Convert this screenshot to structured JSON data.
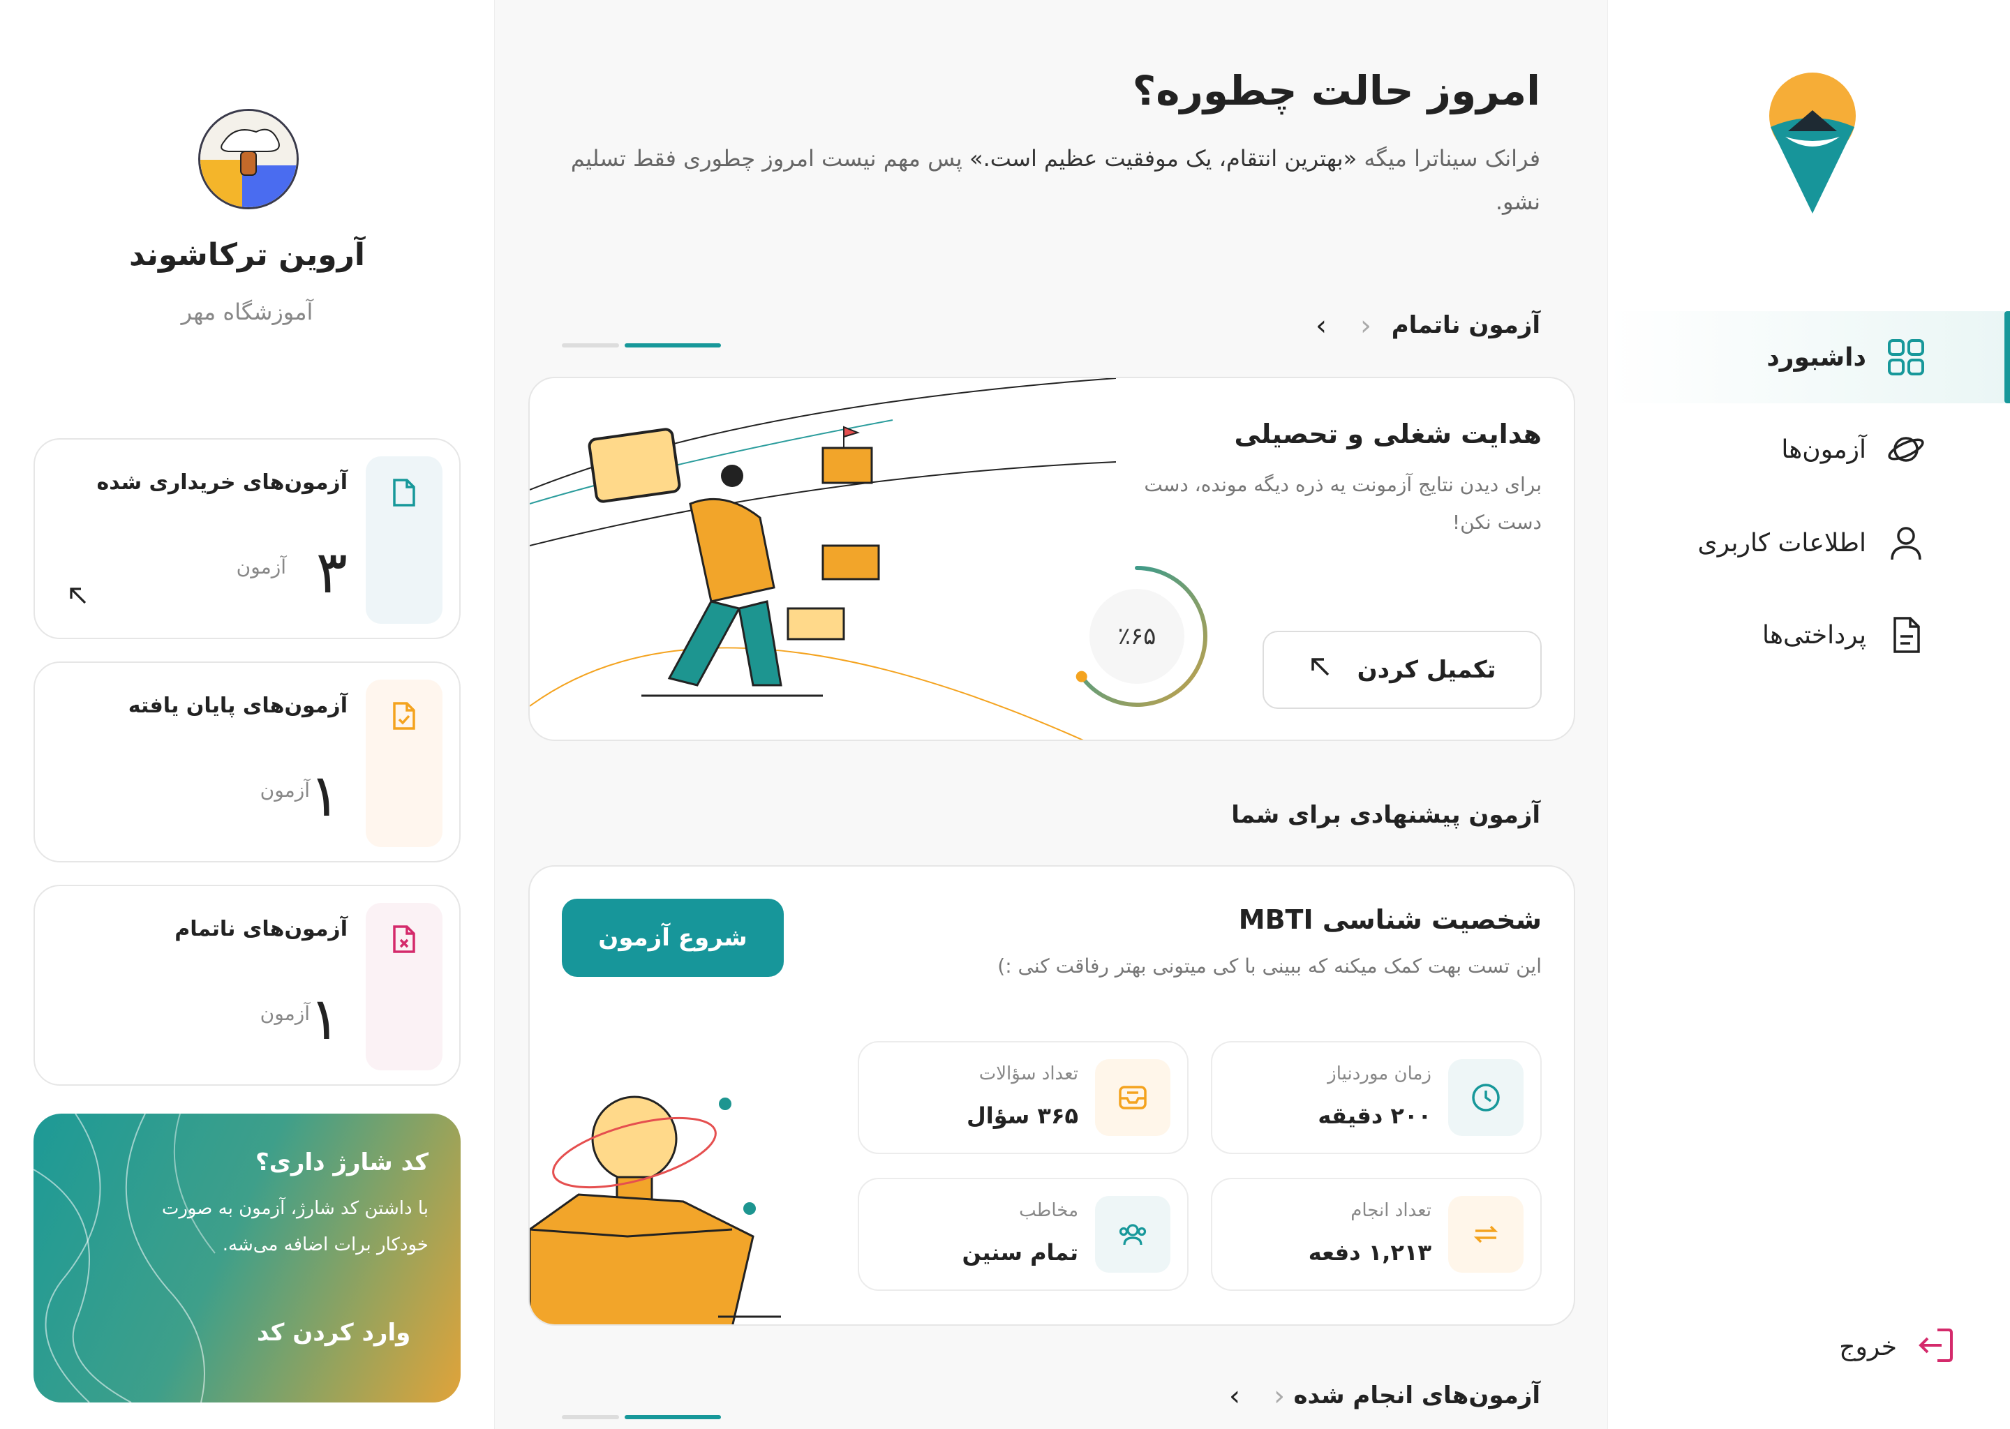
{
  "nav": {
    "items": [
      {
        "label": "داشبورد",
        "icon": "grid-icon",
        "active": true
      },
      {
        "label": "آزمون‌ها",
        "icon": "planet-icon",
        "active": false
      },
      {
        "label": "اطلاعات کاربری",
        "icon": "user-icon",
        "active": false
      },
      {
        "label": "پرداختی‌ها",
        "icon": "document-icon",
        "active": false
      }
    ],
    "logout_label": "خروج"
  },
  "main": {
    "greeting_title": "امروز حالت چطوره؟",
    "quote_prefix": "فرانک سیناترا میگه ",
    "quote_text": "«بهترین انتقام، یک موفقیت عظیم است.»",
    "quote_suffix": " پس مهم نیست امروز چطوری فقط تسلیم نشو.",
    "incomplete_section_title": "آزمون ناتمام",
    "incomplete_card": {
      "title": "هدایت شغلی و تحصیلی",
      "description": "برای دیدن نتایج آزمونت یه ذره دیگه مونده، دست دست نکن!",
      "button_label": "تکمیل کردن",
      "progress_text": "٪۶۵",
      "progress_value": 0.65
    },
    "recommended_section_title": "آزمون پیشنهادی برای شما",
    "recommended_card": {
      "title": "شخصیت شناسی MBTI",
      "description": "این تست بهت کمک میکنه که ببینی با کی میتونی بهتر رفاقت کنی :)",
      "start_label": "شروع آزمون",
      "stats": {
        "time": {
          "label": "زمان موردنیاز",
          "value": "۲۰۰ دقیقه",
          "icon": "clock-icon"
        },
        "questions": {
          "label": "تعداد سؤالات",
          "value": "۳۶۵ سؤال",
          "icon": "inbox-icon"
        },
        "count": {
          "label": "تعداد انجام",
          "value": "۱,۲۱۳ دفعه",
          "icon": "repeat-icon"
        },
        "audience": {
          "label": "مخاطب",
          "value": "تمام سنین",
          "icon": "users-icon"
        }
      }
    },
    "done_section_title": "آزمون‌های انجام شده"
  },
  "profile": {
    "name": "آروین ترکاشوند",
    "school": "آموزشگاه مهر",
    "cards": {
      "bought": {
        "title": "آزمون‌های خریداری شده",
        "count": "۳",
        "unit": "آزمون"
      },
      "done": {
        "title": "آزمون‌های پایان یافته",
        "count": "۱",
        "unit": "آزمون"
      },
      "pending": {
        "title": "آزمون‌های ناتمام",
        "count": "۱",
        "unit": "آزمون"
      }
    },
    "charge": {
      "title": "کد شارژ داری؟",
      "description": "با داشتن کد شارژ، آزمون به صورت خودکار برات اضافه می‌شه.",
      "button_label": "وارد کردن کد"
    }
  },
  "colors": {
    "accent": "#17989a",
    "orange": "#f4a31f",
    "pink": "#d42a6b"
  }
}
